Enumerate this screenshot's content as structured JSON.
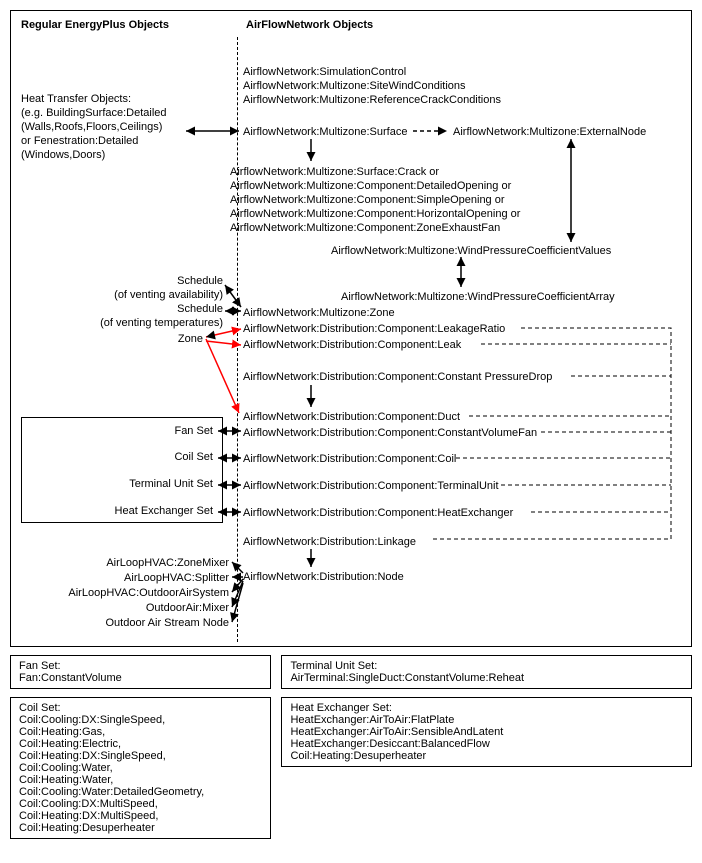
{
  "diagram": {
    "headers": {
      "left": "Regular EnergyPlus Objects",
      "right": "AirFlowNetwork Objects"
    },
    "heat_transfer": {
      "line1": "Heat Transfer Objects:",
      "line2": "(e.g. BuildingSurface:Detailed",
      "line3": "(Walls,Roofs,Floors,Ceilings)",
      "line4": "or Fenestration:Detailed",
      "line5": "(Windows,Doors)"
    },
    "afn": {
      "sim_control": "AirflowNetwork:SimulationControl",
      "site_wind": "AirflowNetwork:Multizone:SiteWindConditions",
      "ref_crack": "AirflowNetwork:Multizone:ReferenceCrackConditions",
      "mz_surface": "AirflowNetwork:Multizone:Surface",
      "ext_node": "AirflowNetwork:Multizone:ExternalNode",
      "crack": "AirflowNetwork:Multizone:Surface:Crack or",
      "detailed_opening": "AirflowNetwork:Multizone:Component:DetailedOpening or",
      "simple_opening": "AirflowNetwork:Multizone:Component:SimpleOpening or",
      "horiz_opening": "AirflowNetwork:Multizone:Component:HorizontalOpening or",
      "exhaust_fan": "AirflowNetwork:Multizone:Component:ZoneExhaustFan",
      "wind_coef_values": "AirflowNetwork:Multizone:WindPressureCoefficientValues",
      "wind_coef_array": "AirflowNetwork:Multizone:WindPressureCoefficientArray",
      "mz_zone": "AirflowNetwork:Multizone:Zone",
      "leak_ratio": "AirflowNetwork:Distribution:Component:LeakageRatio",
      "leak": "AirflowNetwork:Distribution:Component:Leak",
      "const_pressure": "AirflowNetwork:Distribution:Component:Constant PressureDrop",
      "duct": "AirflowNetwork:Distribution:Component:Duct",
      "cv_fan": "AirflowNetwork:Distribution:Component:ConstantVolumeFan",
      "coil": "AirflowNetwork:Distribution:Component:Coil",
      "terminal": "AirflowNetwork:Distribution:Component:TerminalUnit",
      "heat_ex": "AirflowNetwork:Distribution:Component:HeatExchanger",
      "linkage": "AirflowNetwork:Distribution:Linkage",
      "node": "AirflowNetwork:Distribution:Node"
    },
    "left": {
      "sched_avail": "Schedule",
      "sched_avail_sub": "(of venting availability)",
      "sched_temp": "Schedule",
      "sched_temp_sub": "(of venting temperatures)",
      "zone": "Zone",
      "fan_set": "Fan Set",
      "coil_set": "Coil Set",
      "terminal_set": "Terminal Unit Set",
      "heat_ex_set": "Heat Exchanger Set",
      "zone_mixer": "AirLoopHVAC:ZoneMixer",
      "splitter": "AirLoopHVAC:Splitter",
      "oa_system": "AirLoopHVAC:OutdoorAirSystem",
      "oa_mixer": "OutdoorAir:Mixer",
      "oa_stream": "Outdoor Air Stream Node"
    }
  },
  "boxes": {
    "fan_set": {
      "title": "Fan Set:",
      "items": [
        "Fan:ConstantVolume"
      ]
    },
    "terminal_set": {
      "title": "Terminal Unit Set:",
      "items": [
        "AirTerminal:SingleDuct:ConstantVolume:Reheat"
      ]
    },
    "coil_set": {
      "title": "Coil Set:",
      "items": [
        "Coil:Cooling:DX:SingleSpeed,",
        "Coil:Heating:Gas,",
        "Coil:Heating:Electric,",
        "Coil:Heating:DX:SingleSpeed,",
        "Coil:Cooling:Water,",
        "Coil:Heating:Water,",
        "Coil:Cooling:Water:DetailedGeometry,",
        "Coil:Cooling:DX:MultiSpeed,",
        "Coil:Heating:DX:MultiSpeed,",
        "Coil:Heating:Desuperheater"
      ]
    },
    "heat_ex_set": {
      "title": "Heat Exchanger Set:",
      "items": [
        "HeatExchanger:AirToAir:FlatPlate",
        "HeatExchanger:AirToAir:SensibleAndLatent",
        "HeatExchanger:Desiccant:BalancedFlow",
        "Coil:Heating:Desuperheater"
      ]
    }
  }
}
